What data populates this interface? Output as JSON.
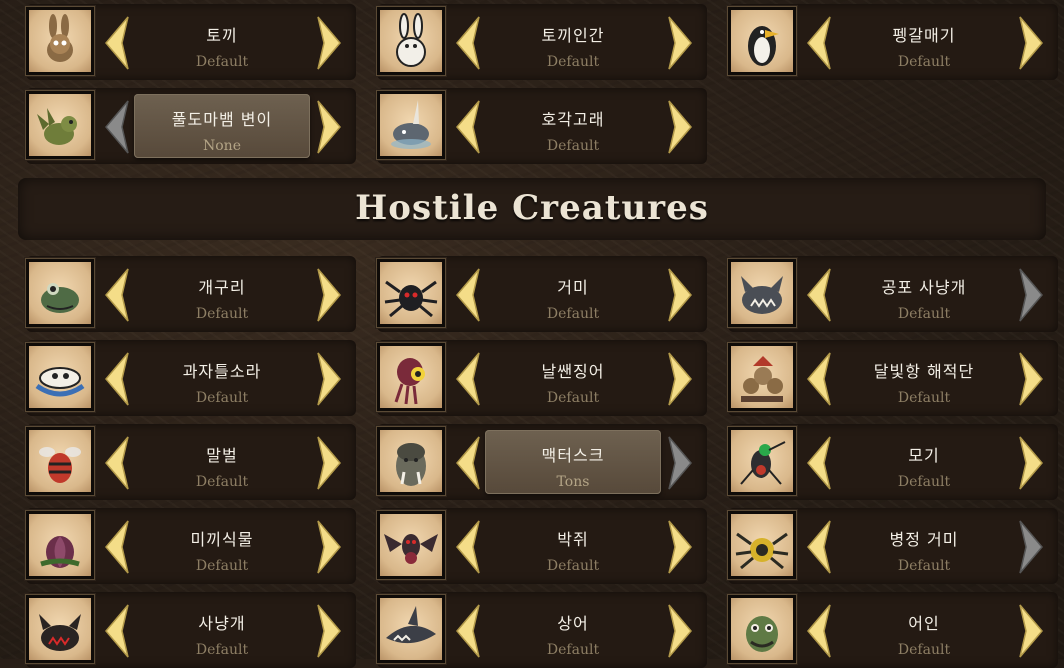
{
  "colors": {
    "arrow_gold": "#f4dd88",
    "arrow_gray": "#8a8a8a",
    "text_name": "#f3efe6",
    "text_value": "#8d7e64"
  },
  "top_rows": [
    [
      {
        "name": "토끼",
        "value": "Default",
        "icon": "rabbit-icon",
        "left_state": "gold",
        "right_state": "gold",
        "selected": false
      },
      {
        "name": "토끼인간",
        "value": "Default",
        "icon": "bunnyman-icon",
        "left_state": "gold",
        "right_state": "gold",
        "selected": false
      },
      {
        "name": "펭갈매기",
        "value": "Default",
        "icon": "pengull-icon",
        "left_state": "gold",
        "right_state": "gold",
        "selected": false
      }
    ],
    [
      {
        "name": "풀도마뱀 변이",
        "value": "None",
        "icon": "grass-gekko-icon",
        "left_state": "gray",
        "right_state": "gold",
        "selected": true
      },
      {
        "name": "호각고래",
        "value": "Default",
        "icon": "narwhal-icon",
        "left_state": "gold",
        "right_state": "gold",
        "selected": false
      }
    ]
  ],
  "section": {
    "title": "Hostile Creatures"
  },
  "hostile_rows": [
    [
      {
        "name": "개구리",
        "value": "Default",
        "icon": "frog-icon",
        "left_state": "gold",
        "right_state": "gold",
        "selected": false
      },
      {
        "name": "거미",
        "value": "Default",
        "icon": "spider-icon",
        "left_state": "gold",
        "right_state": "gold",
        "selected": false
      },
      {
        "name": "공포 사냥개",
        "value": "Default",
        "icon": "horror-hound-icon",
        "left_state": "gold",
        "right_state": "gray",
        "selected": false
      }
    ],
    [
      {
        "name": "과자틀소라",
        "value": "Default",
        "icon": "cookie-cutter-icon",
        "left_state": "gold",
        "right_state": "gold",
        "selected": false
      },
      {
        "name": "날쌘징어",
        "value": "Default",
        "icon": "squid-icon",
        "left_state": "gold",
        "right_state": "gold",
        "selected": false
      },
      {
        "name": "달빛항 해적단",
        "value": "Default",
        "icon": "moon-quay-pirates-icon",
        "left_state": "gold",
        "right_state": "gold",
        "selected": false
      }
    ],
    [
      {
        "name": "말벌",
        "value": "Default",
        "icon": "killer-bee-icon",
        "left_state": "gold",
        "right_state": "gold",
        "selected": false
      },
      {
        "name": "맥터스크",
        "value": "Tons",
        "icon": "mactusk-icon",
        "left_state": "gold",
        "right_state": "gray",
        "selected": true
      },
      {
        "name": "모기",
        "value": "Default",
        "icon": "mosquito-icon",
        "left_state": "gold",
        "right_state": "gold",
        "selected": false
      }
    ],
    [
      {
        "name": "미끼식물",
        "value": "Default",
        "icon": "lureplant-icon",
        "left_state": "gold",
        "right_state": "gold",
        "selected": false
      },
      {
        "name": "박쥐",
        "value": "Default",
        "icon": "batilisk-icon",
        "left_state": "gold",
        "right_state": "gold",
        "selected": false
      },
      {
        "name": "병정 거미",
        "value": "Default",
        "icon": "spider-warrior-icon",
        "left_state": "gold",
        "right_state": "gray",
        "selected": false
      }
    ],
    [
      {
        "name": "사냥개",
        "value": "Default",
        "icon": "hound-icon",
        "left_state": "gold",
        "right_state": "gold",
        "selected": false
      },
      {
        "name": "상어",
        "value": "Default",
        "icon": "shark-icon",
        "left_state": "gold",
        "right_state": "gold",
        "selected": false
      },
      {
        "name": "어인",
        "value": "Default",
        "icon": "merm-icon",
        "left_state": "gold",
        "right_state": "gold",
        "selected": false
      }
    ]
  ]
}
